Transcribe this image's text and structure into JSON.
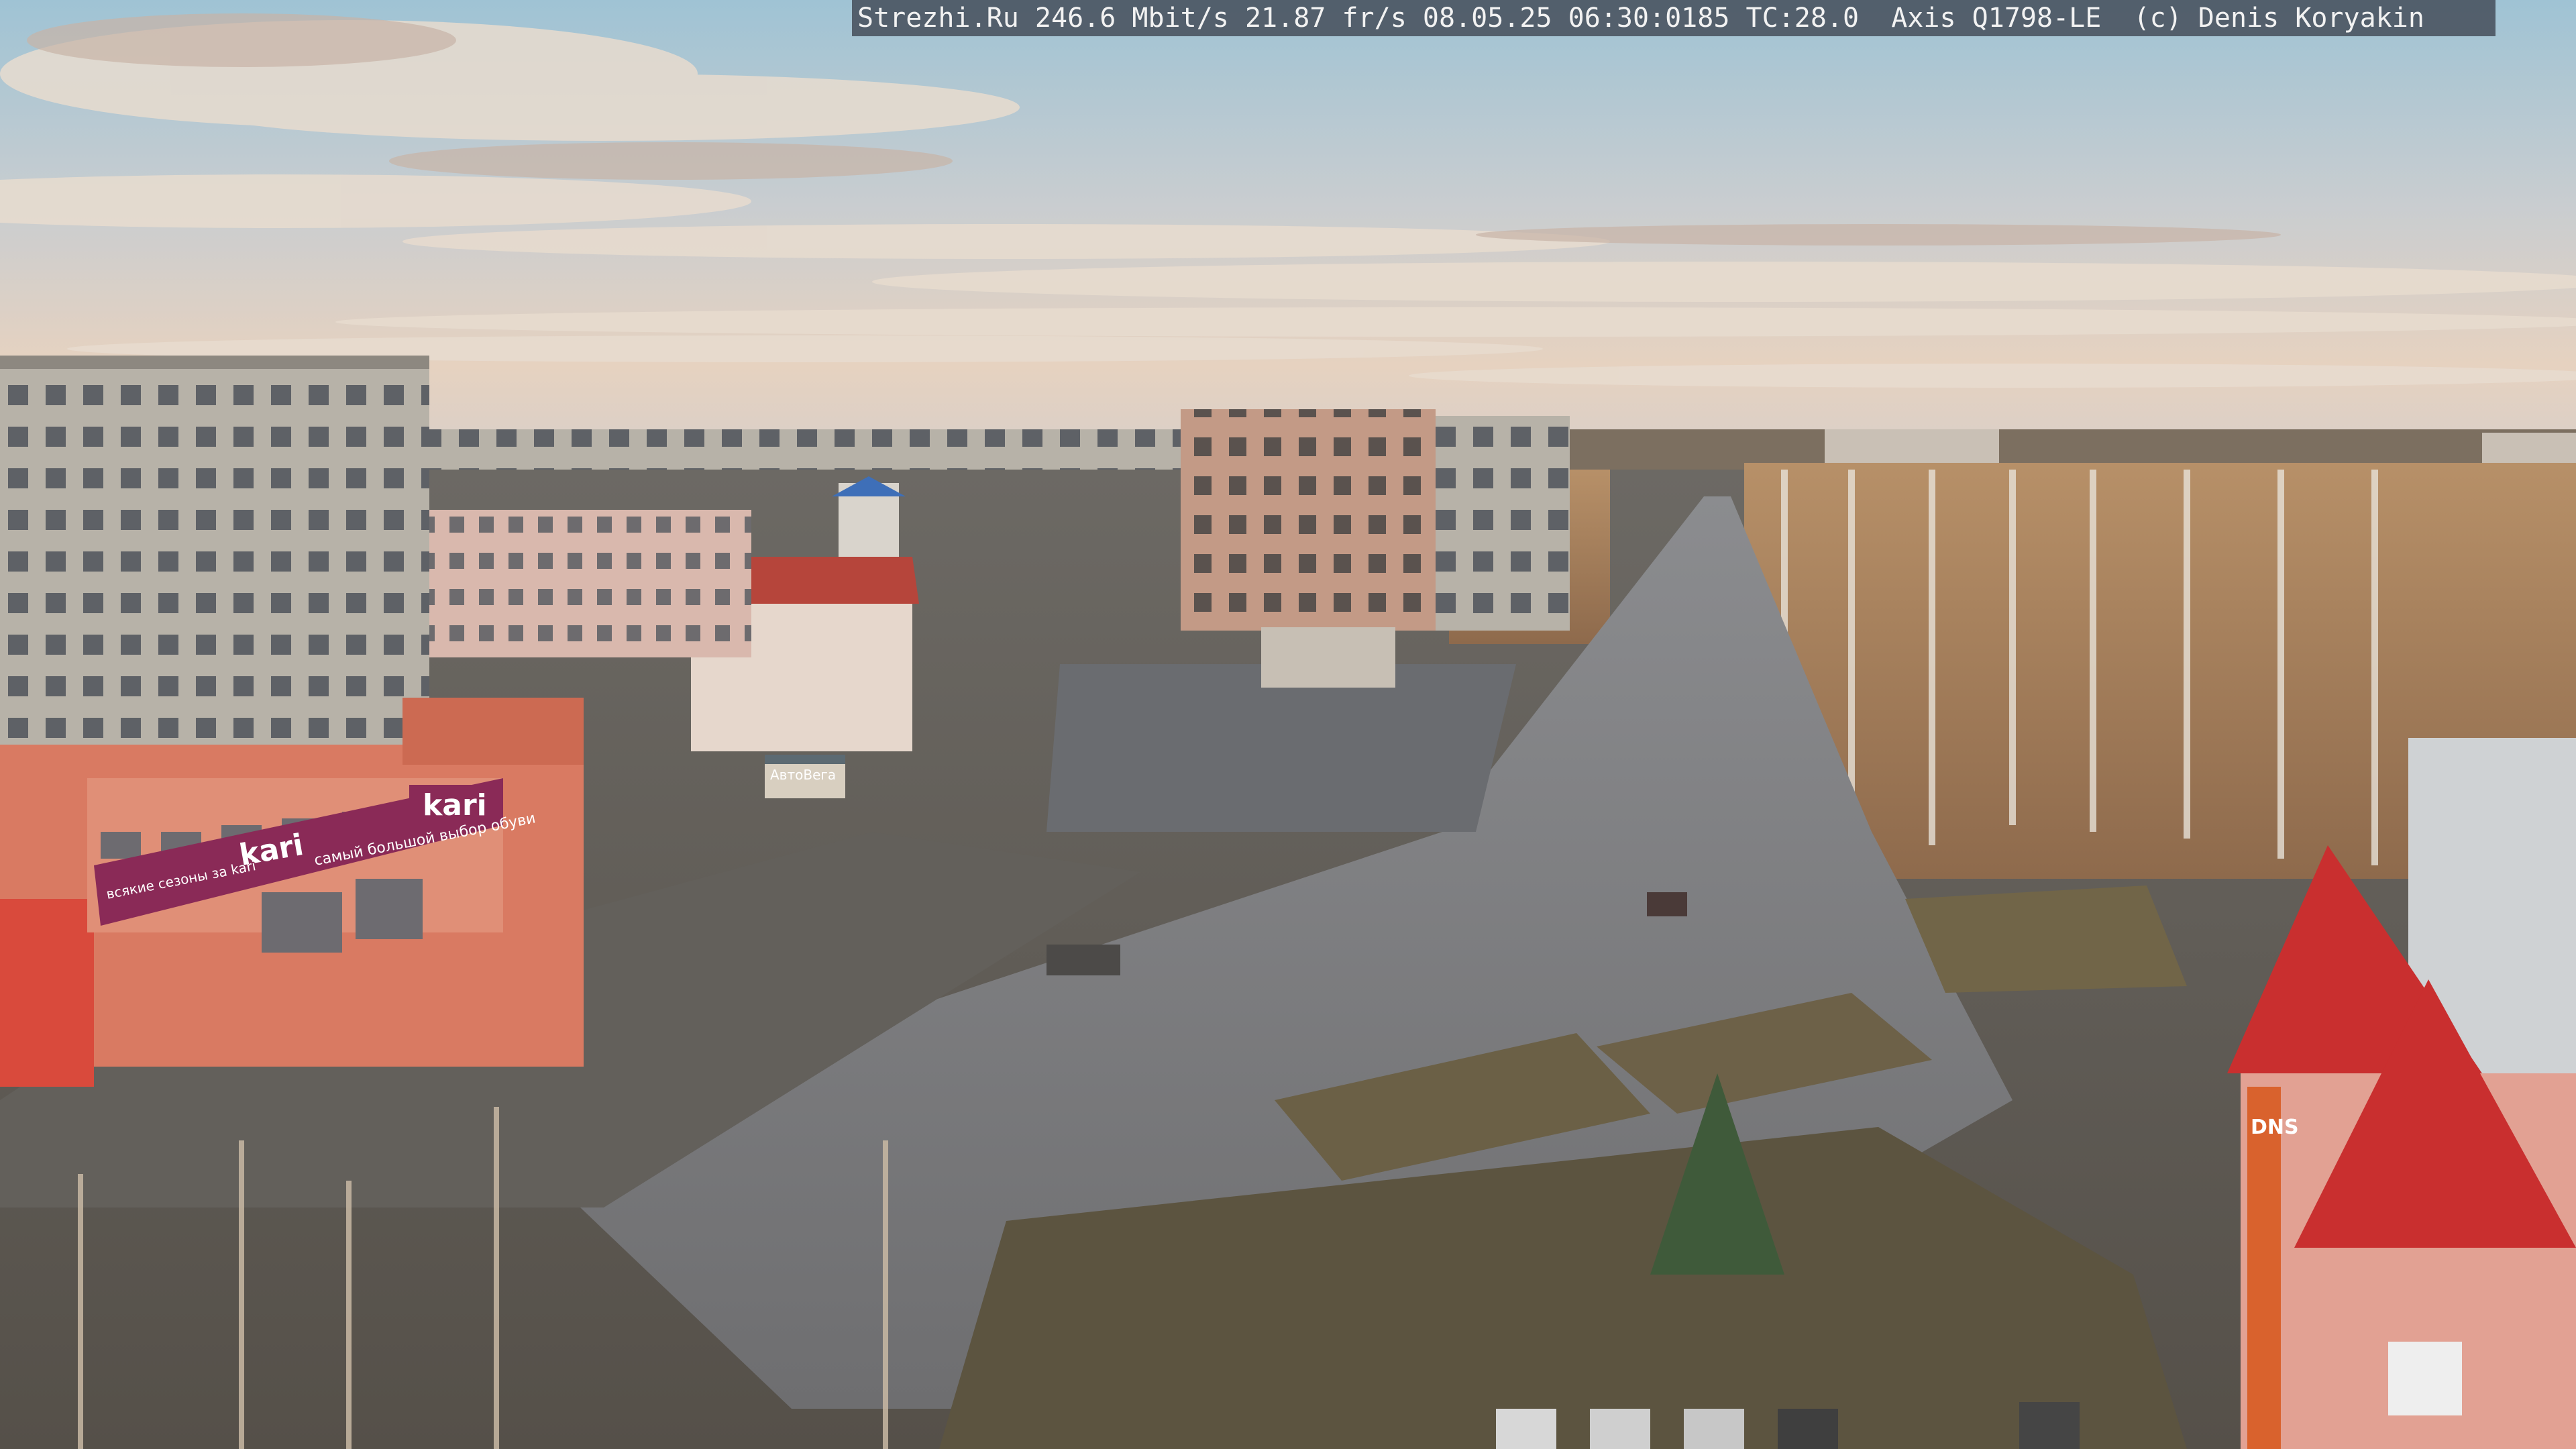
{
  "overlay": {
    "camera_text": "Strezhi.Ru 246.6 Mbit/s 21.87 fr/s 08.05.25 06:30:0185 TC:28.0  Axis Q1798-LE  (c) Denis Koryakin"
  },
  "signs": {
    "store_sign_top": "kari",
    "store_sign_front": "kari",
    "store_banner_slogan": "самый большой выбор обуви",
    "store_banner_left": "всякие сезоны за kari",
    "dns_sign": "DNS",
    "shop_sign": "АвтоВега"
  }
}
